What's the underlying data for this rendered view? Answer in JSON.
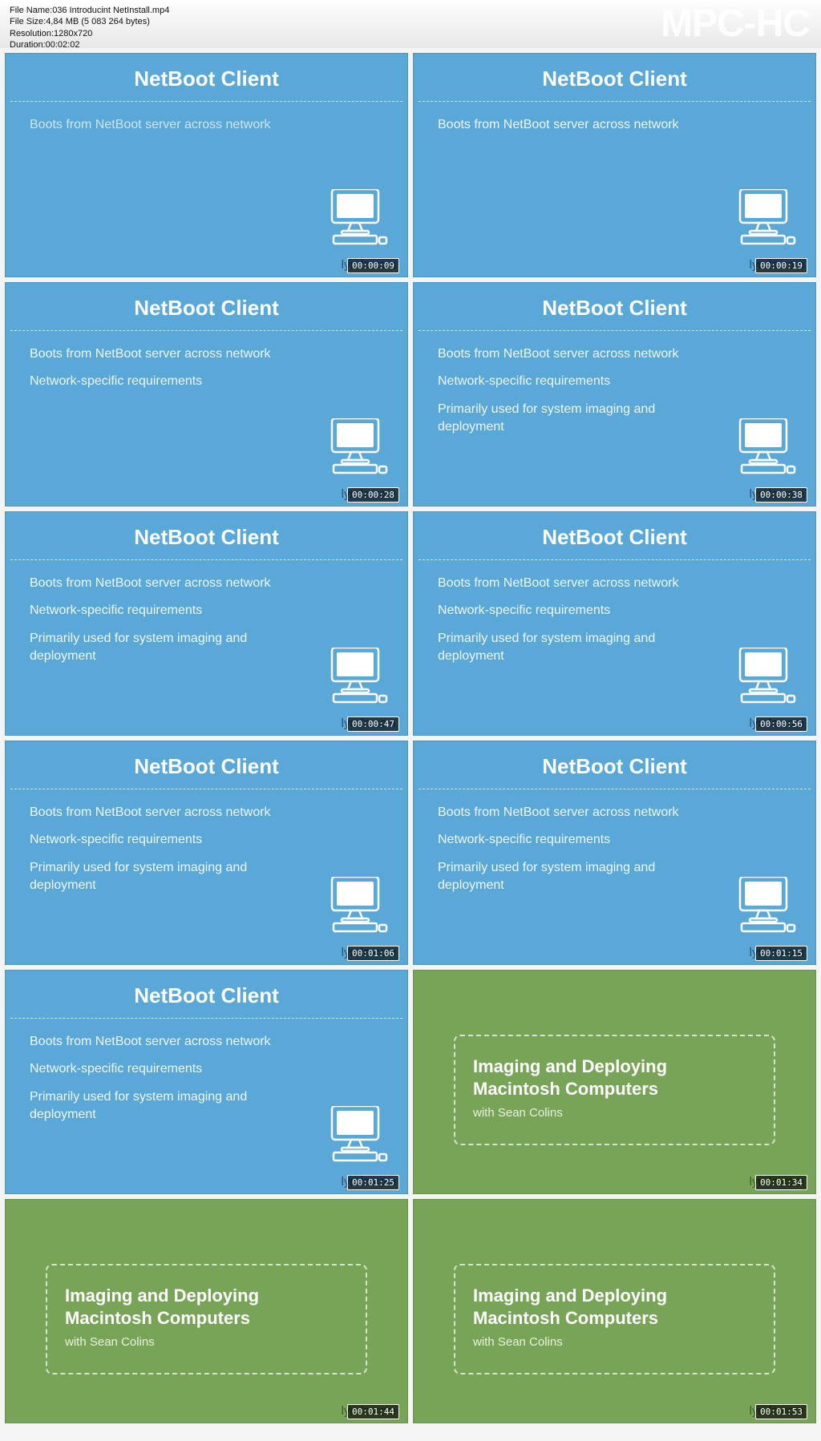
{
  "app_watermark": "MPC-HC",
  "meta": {
    "file_name_label": "File Name: ",
    "file_name": "036 Introducint NetInstall.mp4",
    "file_size_label": "File Size: ",
    "file_size": "4,84 MB (5 083 264 bytes)",
    "resolution_label": "Resolution: ",
    "resolution": "1280x720",
    "duration_label": "Duration: ",
    "duration": "00:02:02"
  },
  "brand_text": "lynda.com",
  "slide_title": "NetBoot Client",
  "bullets": {
    "b1": "Boots from NetBoot server across network",
    "b2": "Network-specific requirements",
    "b3": "Primarily used for system imaging and deployment"
  },
  "green_slide": {
    "title_l1": "Imaging and Deploying",
    "title_l2": "Macintosh Computers",
    "sub": "with Sean Colins"
  },
  "thumbs": [
    {
      "type": "blue",
      "ts": "00:00:09",
      "bullets": [
        "b1"
      ],
      "dim": true
    },
    {
      "type": "blue",
      "ts": "00:00:19",
      "bullets": [
        "b1"
      ]
    },
    {
      "type": "blue",
      "ts": "00:00:28",
      "bullets": [
        "b1",
        "b2"
      ]
    },
    {
      "type": "blue",
      "ts": "00:00:38",
      "bullets": [
        "b1",
        "b2",
        "b3"
      ]
    },
    {
      "type": "blue",
      "ts": "00:00:47",
      "bullets": [
        "b1",
        "b2",
        "b3"
      ]
    },
    {
      "type": "blue",
      "ts": "00:00:56",
      "bullets": [
        "b1",
        "b2",
        "b3"
      ]
    },
    {
      "type": "blue",
      "ts": "00:01:06",
      "bullets": [
        "b1",
        "b2",
        "b3"
      ]
    },
    {
      "type": "blue",
      "ts": "00:01:15",
      "bullets": [
        "b1",
        "b2",
        "b3"
      ]
    },
    {
      "type": "blue",
      "ts": "00:01:25",
      "bullets": [
        "b1",
        "b2",
        "b3"
      ]
    },
    {
      "type": "green",
      "ts": "00:01:34"
    },
    {
      "type": "green",
      "ts": "00:01:44"
    },
    {
      "type": "green",
      "ts": "00:01:53"
    }
  ]
}
